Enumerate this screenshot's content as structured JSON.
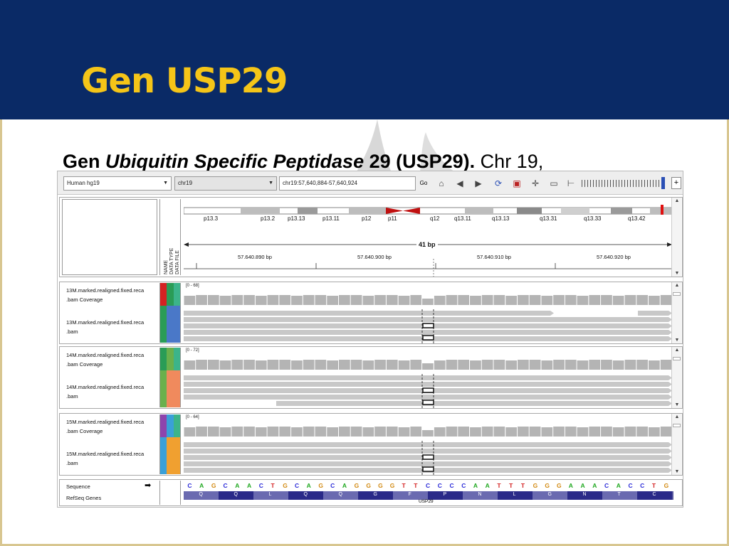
{
  "slide": {
    "title": "Gen USP29",
    "subtitle_prefix": "Gen ",
    "subtitle_italic": "Ubiquitin Specific Peptidase",
    "subtitle_bold": " 29 (USP29).",
    "subtitle_rest": " Chr 19,",
    "colors": {
      "header": "#0a2a66",
      "title": "#f5c518",
      "frame": "#d8c690"
    }
  },
  "toolbar": {
    "genome": "Human hg19",
    "chromosome": "chr19",
    "locus": "chr19:57,640,884-57,640,924",
    "go_label": "Go",
    "icons": [
      "home-icon",
      "back-icon",
      "forward-icon",
      "refresh-icon",
      "roi-icon",
      "select-icon",
      "popup-icon",
      "ruler-icon"
    ]
  },
  "ideogram": {
    "bands": [
      "p13.3",
      "p13.2",
      "p13.13",
      "p13.11",
      "p12",
      "p11",
      "q12",
      "q13.11",
      "q13.13",
      "q13.31",
      "q13.33",
      "q13.42"
    ],
    "span_label": "41 bp",
    "ruler_ticks": [
      "57.640.890 bp",
      "57.640.900 bp",
      "57.640.910 bp",
      "57.640.920 bp"
    ],
    "attribute_headers": "NAME\nDATA TYPE\nDATA FILE"
  },
  "samples": [
    {
      "coverage_label_1": "13M.marked.realigned.fixed.reca",
      "coverage_label_2": ".bam Coverage",
      "bam_label_1": "13M.marked.realigned.fixed.reca",
      "bam_label_2": ".bam",
      "range": "[0 - 68]",
      "colors": [
        "#d42222",
        "#2a9c56",
        "#4a78c8"
      ]
    },
    {
      "coverage_label_1": "14M.marked.realigned.fixed.reca",
      "coverage_label_2": ".bam Coverage",
      "bam_label_1": "14M.marked.realigned.fixed.reca",
      "bam_label_2": ".bam",
      "range": "[0 - 72]",
      "colors": [
        "#2a9c56",
        "#6ab04c",
        "#f08a5d"
      ]
    },
    {
      "coverage_label_1": "15M.marked.realigned.fixed.reca",
      "coverage_label_2": ".bam Coverage",
      "bam_label_1": "15M.marked.realigned.fixed.reca",
      "bam_label_2": ".bam",
      "range": "[0 - 64]",
      "colors": [
        "#8e44ad",
        "#3aa0d8",
        "#f0a030"
      ]
    }
  ],
  "reference": {
    "sequence_label": "Sequence",
    "genes_label": "RefSeq Genes",
    "sequence": [
      "C",
      "A",
      "G",
      "C",
      "A",
      "A",
      "C",
      "T",
      "G",
      "C",
      "A",
      "G",
      "C",
      "A",
      "G",
      "G",
      "G",
      "G",
      "T",
      "T",
      "C",
      "C",
      "C",
      "C",
      "A",
      "A",
      "T",
      "T",
      "T",
      "G",
      "G",
      "G",
      "A",
      "A",
      "A",
      "C",
      "A",
      "C",
      "C",
      "T",
      "G"
    ],
    "amino_acids": [
      "Q",
      "Q",
      "L",
      "Q",
      "Q",
      "G",
      "F",
      "P",
      "N",
      "L",
      "G",
      "N",
      "T",
      "C"
    ],
    "gene_name": "USP29",
    "base_colors": {
      "A": "#1fa81f",
      "C": "#2b2bd8",
      "G": "#d28a12",
      "T": "#d42222"
    }
  }
}
